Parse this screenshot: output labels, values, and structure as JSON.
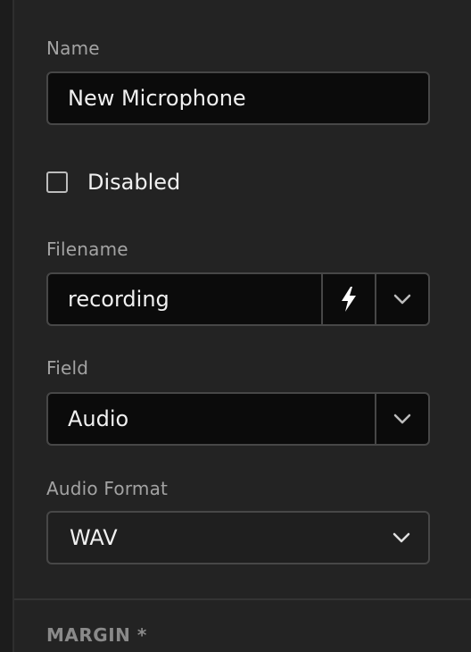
{
  "name_field": {
    "label": "Name",
    "value": "New Microphone"
  },
  "disabled_checkbox": {
    "label": "Disabled",
    "checked": false
  },
  "filename_field": {
    "label": "Filename",
    "value": "recording",
    "action_icon": "lightning-bolt-icon",
    "dropdown_icon": "chevron-down-icon"
  },
  "field_select": {
    "label": "Field",
    "value": "Audio",
    "dropdown_icon": "chevron-down-icon"
  },
  "audio_format_select": {
    "label": "Audio Format",
    "value": "WAV",
    "dropdown_icon": "chevron-down-icon"
  },
  "margin_section": {
    "title": "MARGIN *"
  },
  "colors": {
    "background": "#232323",
    "input_background": "#0b0b0b",
    "border": "#474747",
    "label": "#a3a3a3",
    "text": "#f0f0f0"
  }
}
